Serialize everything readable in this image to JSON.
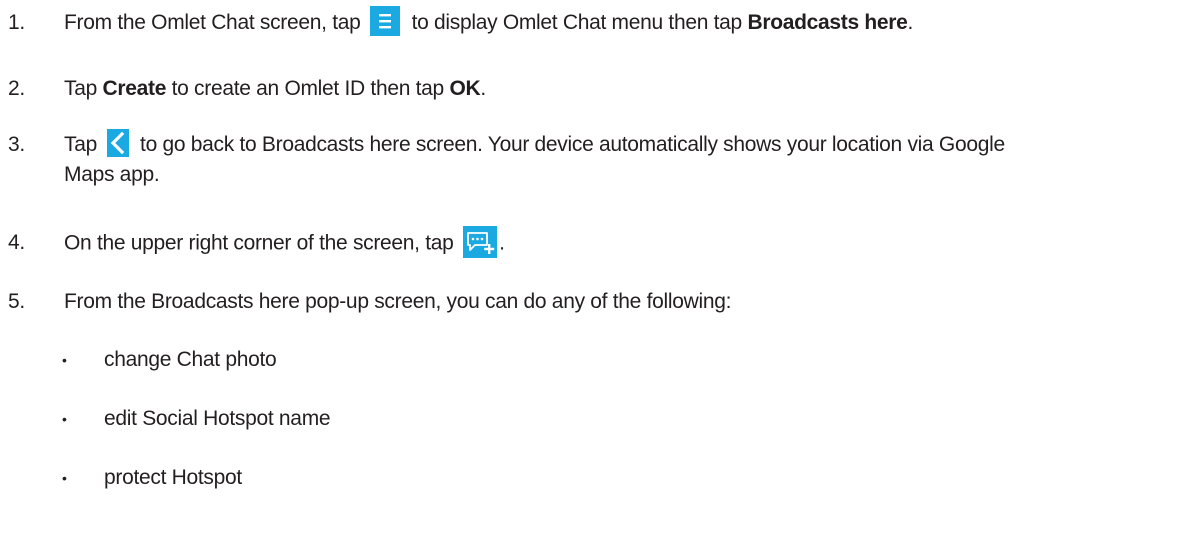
{
  "steps": [
    {
      "num": "1.",
      "t1": "From the Omlet Chat screen, tap ",
      "icon": "menu-icon",
      "t2": " to display Omlet Chat menu then tap ",
      "b1": "Broadcasts here",
      "t3": "."
    },
    {
      "num": "2.",
      "t1": "Tap ",
      "b1": "Create",
      "t2": " to create an Omlet ID then tap ",
      "b2": "OK",
      "t3": "."
    },
    {
      "num": "3.",
      "t1": "Tap ",
      "icon": "back-icon",
      "t2": " to go back to Broadcasts here screen. Your device automatically shows your location via Google",
      "t3": "Maps app."
    },
    {
      "num": "4.",
      "t1": "On the upper right corner of the screen, tap ",
      "icon": "new-chat-icon",
      "t2": "."
    },
    {
      "num": "5.",
      "t1": "From the Broadcasts here pop-up screen, you can do any of the following:"
    }
  ],
  "bullets": [
    "change Chat photo",
    "edit Social Hotspot name",
    "protect Hotspot"
  ],
  "bullet_char": "•",
  "colors": {
    "icon_background": "#1aa9e1",
    "text": "#231f20"
  }
}
